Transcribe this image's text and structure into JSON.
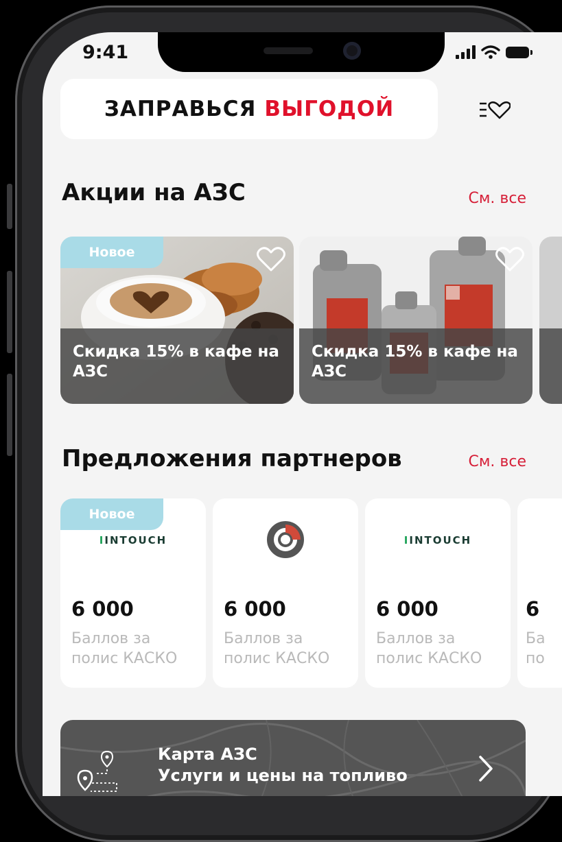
{
  "status_bar": {
    "time": "9:41"
  },
  "header": {
    "logo_part1": "ЗАПРАВЬСЯ",
    "logo_part2": "ВЫГОДОЙ",
    "favorites_icon": "favorites-list-icon"
  },
  "promotions": {
    "title": "Акции на АЗС",
    "see_all": "См. все",
    "items": [
      {
        "badge": "Новое",
        "caption": "Скидка 15% в кафе на АЗС",
        "image": "coffee-and-croissant"
      },
      {
        "caption": "Скидка 15% в кафе на АЗС",
        "image": "lukoil-motor-oil-canisters"
      }
    ]
  },
  "partners": {
    "title": "Предложения партнеров",
    "see_all": "См. все",
    "items": [
      {
        "badge": "Новое",
        "logo_text": "INTOUCH",
        "points": "6 000",
        "description": "Баллов за полис КАСКО"
      },
      {
        "logo": "partner-ring-logo",
        "points": "6 000",
        "description": "Баллов за полис КАСКО"
      },
      {
        "logo_text": "INTOUCH",
        "points": "6 000",
        "description": "Баллов за полис КАСКО"
      },
      {
        "points": "6",
        "description": "Ба по"
      }
    ]
  },
  "map_banner": {
    "line1": "Карта АЗС",
    "line2": "Услуги и цены на топливо",
    "icon": "route-pin-icon"
  },
  "colors": {
    "accent_red": "#e0112b",
    "link_red": "#d61f38",
    "badge_blue": "#a9dbe7",
    "intouch_green": "#21a35a"
  }
}
